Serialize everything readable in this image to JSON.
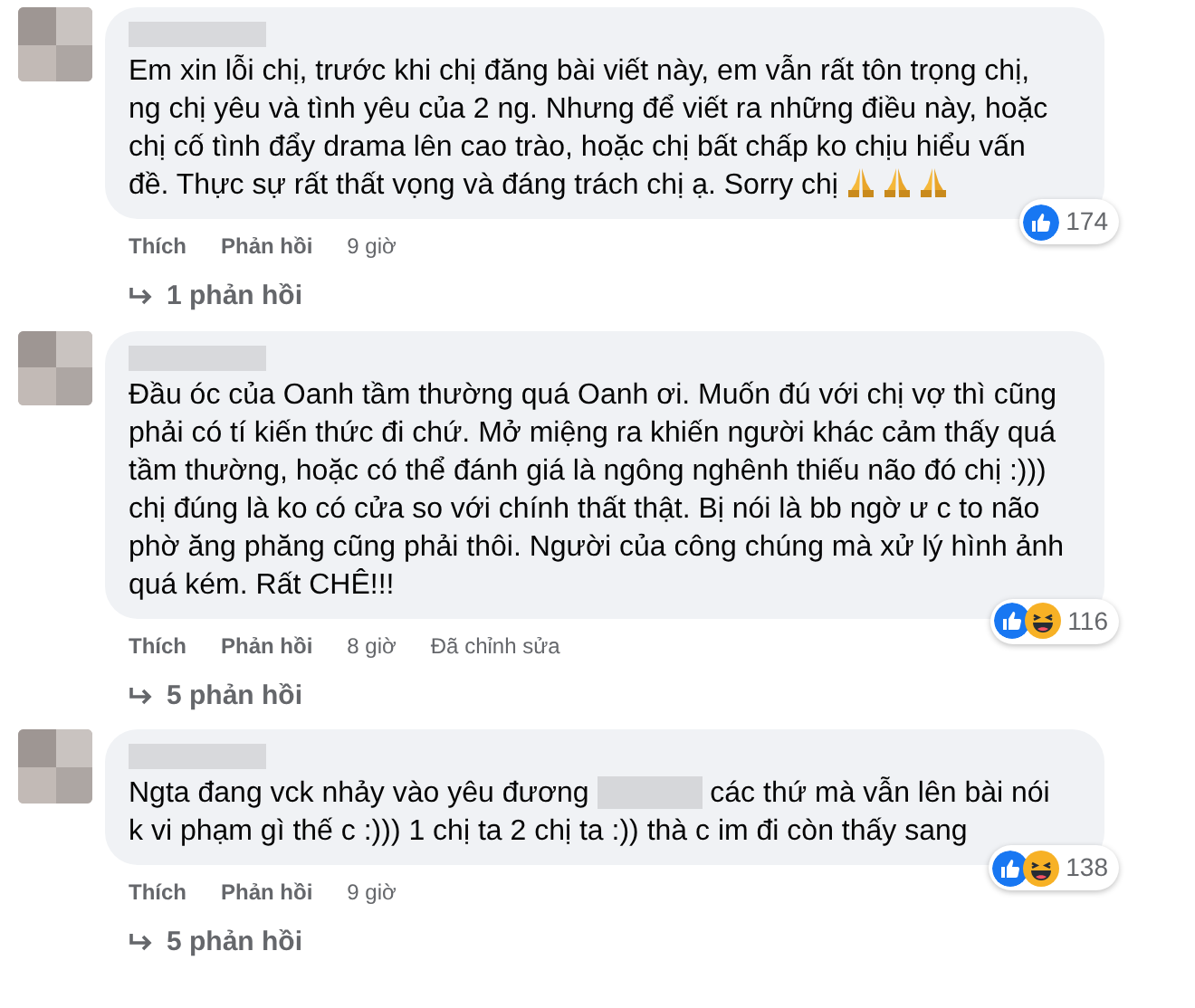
{
  "comments": [
    {
      "body": [
        {
          "kind": "text",
          "text": "Em xin lỗi chị, trước khi chị đăng bài viết này, em vẫn rất tôn trọng chị, ng chị yêu và tình yêu của 2 ng. Nhưng để viết ra những điều này, hoặc chị cố tình đẩy drama lên cao trào, hoặc chị bất chấp ko chịu hiểu vấn đề. Thực sự rất thất vọng và đáng trách chị ạ. Sorry chị "
        },
        {
          "kind": "pray"
        },
        {
          "kind": "pray"
        },
        {
          "kind": "pray"
        }
      ],
      "reactions": [
        {
          "kind": "like"
        }
      ],
      "reaction_count": "174",
      "like": "Thích",
      "reply": "Phản hồi",
      "time": "9 giờ",
      "replies": "1 phản hồi"
    },
    {
      "body": [
        {
          "kind": "text",
          "text": "Đầu óc của Oanh tầm thường quá Oanh ơi. Muốn đú với chị vợ thì cũng phải có tí kiến thức đi chứ. Mở miệng ra khiến người khác cảm thấy quá tầm thường, hoặc có thể đánh giá là ngông nghênh thiếu não đó chị :))) chị đúng là ko có cửa so với chính thất thật. Bị nói là bb ngờ ư c to não phờ ăng phăng cũng phải thôi. Người của công chúng mà xử lý hình ảnh quá kém. Rất CHÊ!!!"
        }
      ],
      "reactions": [
        {
          "kind": "like"
        },
        {
          "kind": "haha"
        }
      ],
      "reaction_count": "116",
      "like": "Thích",
      "reply": "Phản hồi",
      "time": "8 giờ",
      "edited": "Đã chỉnh sửa",
      "replies": "5 phản hồi"
    },
    {
      "body": [
        {
          "kind": "text",
          "text": "Ngta đang vck nhảy vào yêu đương "
        },
        {
          "kind": "redaction"
        },
        {
          "kind": "text",
          "text": " các thứ mà vẫn lên bài nói k vi phạm gì thế c :))) 1 chị ta 2 chị ta :)) thà c im đi còn thấy sang"
        }
      ],
      "reactions": [
        {
          "kind": "like"
        },
        {
          "kind": "haha"
        }
      ],
      "reaction_count": "138",
      "like": "Thích",
      "reply": "Phản hồi",
      "time": "9 giờ",
      "replies": "5 phản hồi"
    }
  ]
}
